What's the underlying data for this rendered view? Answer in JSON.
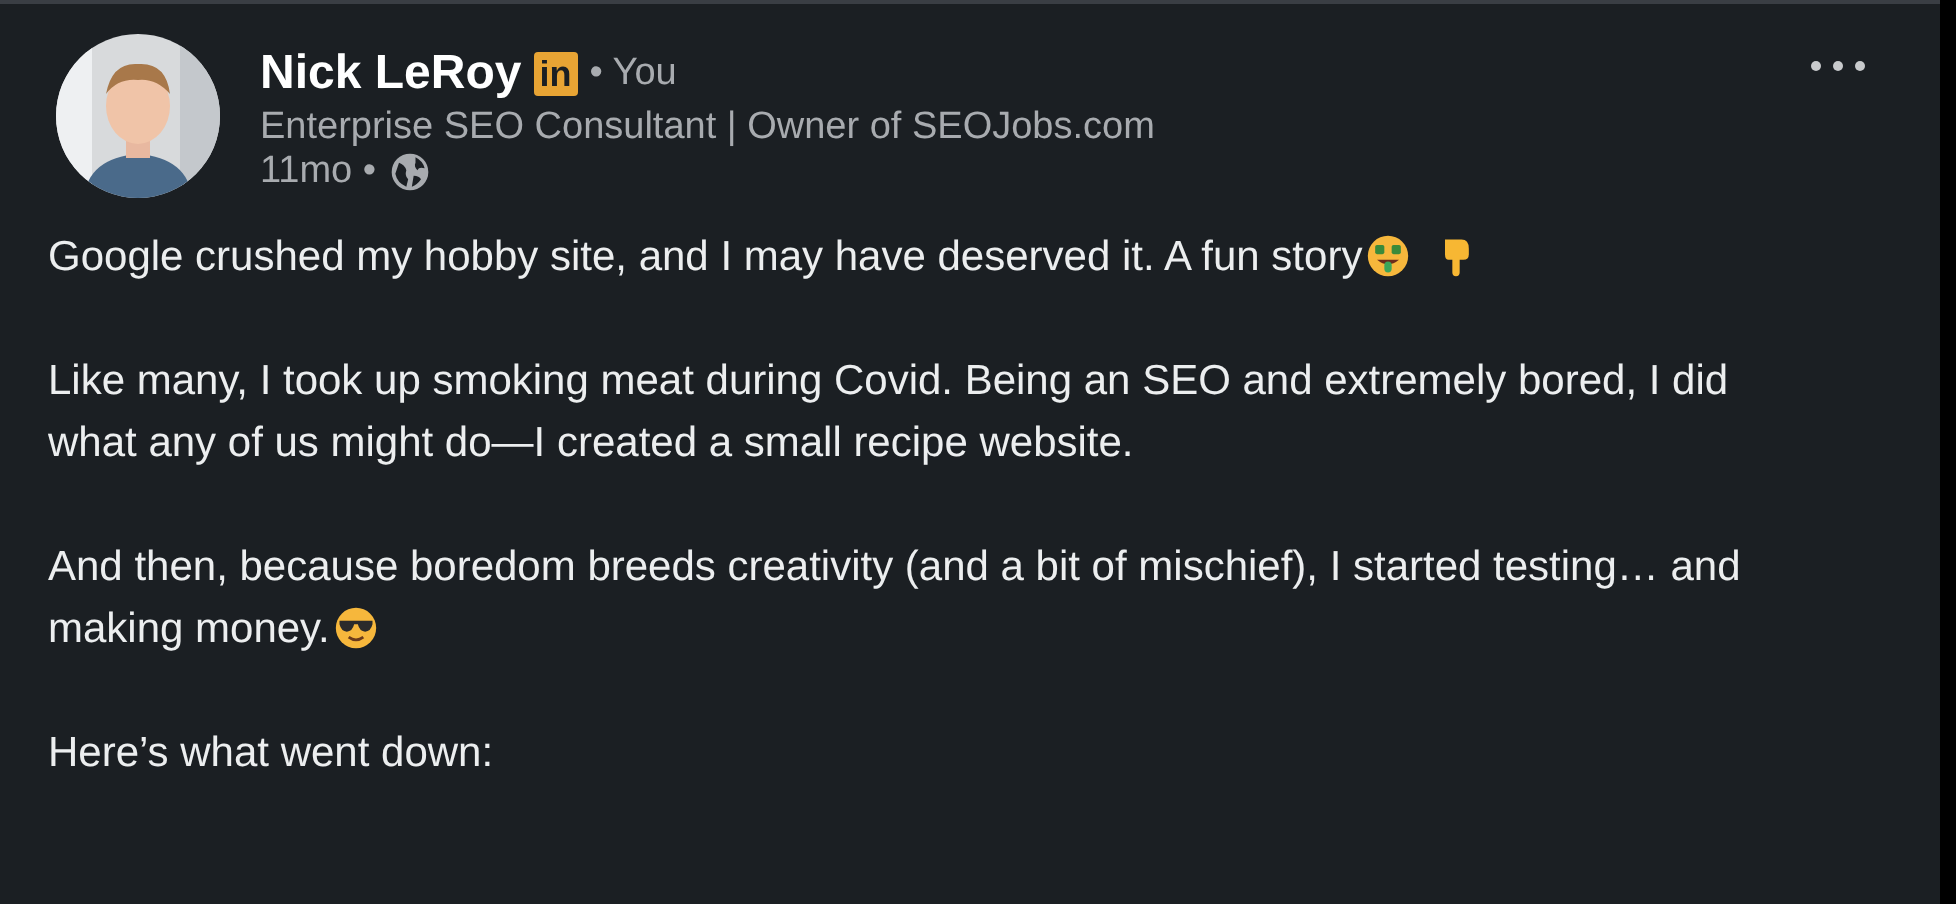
{
  "author": {
    "name": "Nick LeRoy",
    "badge": "in",
    "relation": "• You",
    "headline": "Enterprise SEO Consultant | Owner of SEOJobs.com",
    "age": "11mo •"
  },
  "paragraphs": [
    {
      "text": "Google crushed my hobby site, and I may have deserved it. A fun story",
      "emojis": [
        {
          "kind": "money"
        },
        {
          "kind": "hand"
        }
      ]
    },
    {
      "text": "Like many, I took up smoking meat during Covid. Being an SEO and extremely bored, I did what any of us might do—I created a small recipe website."
    },
    {
      "text": "And then, because boredom breeds creativity (and a bit of mischief), I started testing… and making money.",
      "emojis": [
        {
          "kind": "cool"
        }
      ]
    },
    {
      "text": "Here’s what went down:"
    }
  ]
}
